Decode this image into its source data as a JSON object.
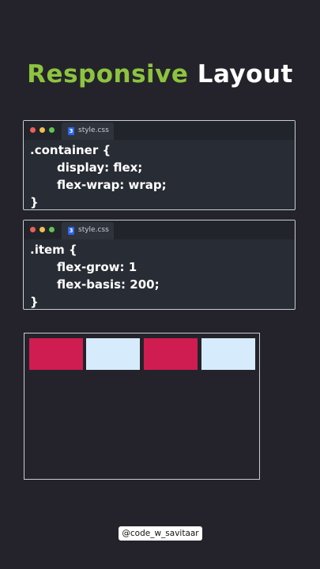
{
  "title": {
    "word1": "Responsive",
    "word2": "Layout"
  },
  "colors": {
    "accent_green": "#8dc43f",
    "item_crimson": "#cf1d51",
    "item_light_blue": "#d6ecfd",
    "background": "#24232b"
  },
  "editor1": {
    "tab_label": "style.css",
    "tab_icon": "css3-icon",
    "lines": [
      ".container {",
      "display: flex;",
      "flex-wrap: wrap;",
      "}"
    ]
  },
  "editor2": {
    "tab_label": "style.css",
    "tab_icon": "css3-icon",
    "lines": [
      ".item {",
      "flex-grow: 1",
      "flex-basis: 200;",
      "}"
    ]
  },
  "demo": {
    "items": [
      {
        "color": "#cf1d51"
      },
      {
        "color": "#d6ecfd"
      },
      {
        "color": "#cf1d51"
      },
      {
        "color": "#d6ecfd"
      }
    ]
  },
  "handle": "@code_w_savitaar"
}
